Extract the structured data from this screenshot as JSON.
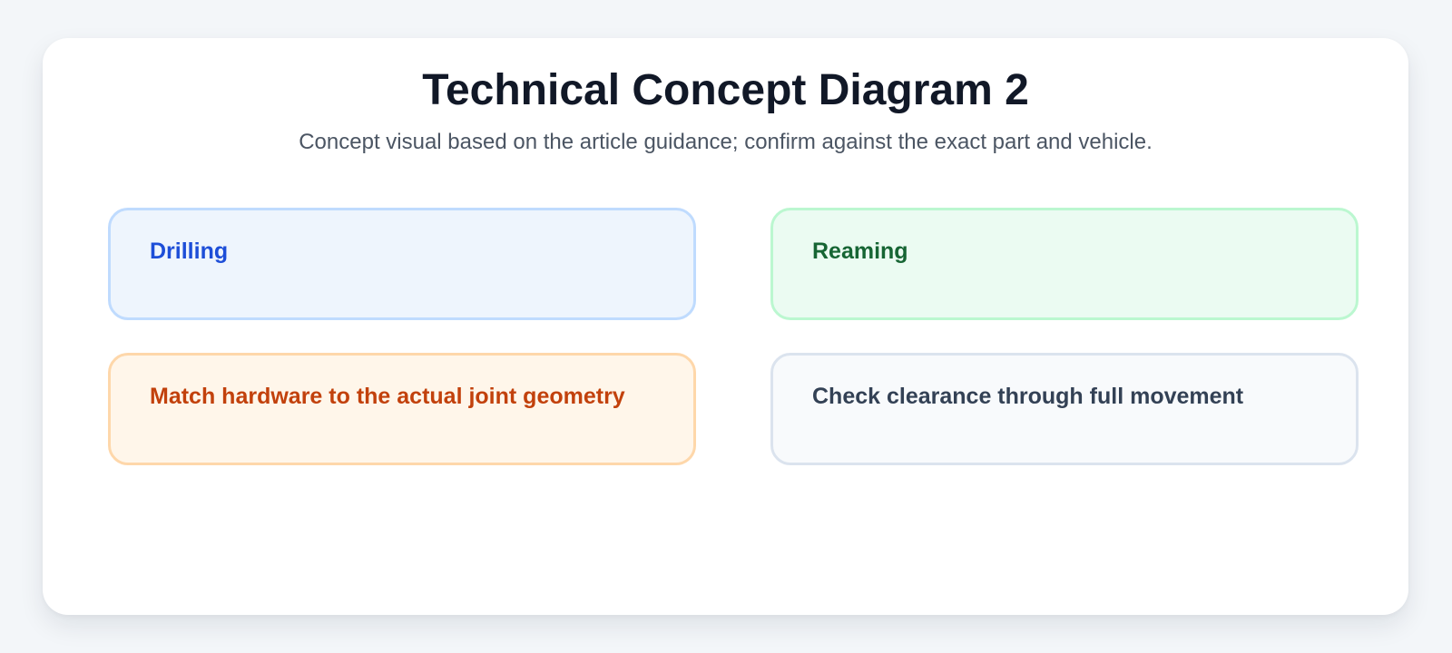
{
  "diagram": {
    "title": "Technical Concept Diagram 2",
    "subtitle": "Concept visual based on the article guidance; confirm against the exact part and vehicle.",
    "boxes": [
      {
        "label": "Drilling",
        "text_color": "#1d4ed8",
        "fill": "#eef5fd",
        "border": "#bfdbfe"
      },
      {
        "label": "Reaming",
        "text_color": "#166534",
        "fill": "#ebfbf2",
        "border": "#bbf7d0"
      },
      {
        "label": "Match hardware to the actual joint geometry",
        "text_color": "#c2410c",
        "fill": "#fff6ea",
        "border": "#fed7aa"
      },
      {
        "label": "Check clearance through full movement",
        "text_color": "#334155",
        "fill": "#f8fafc",
        "border": "#dbe3ee"
      }
    ]
  }
}
